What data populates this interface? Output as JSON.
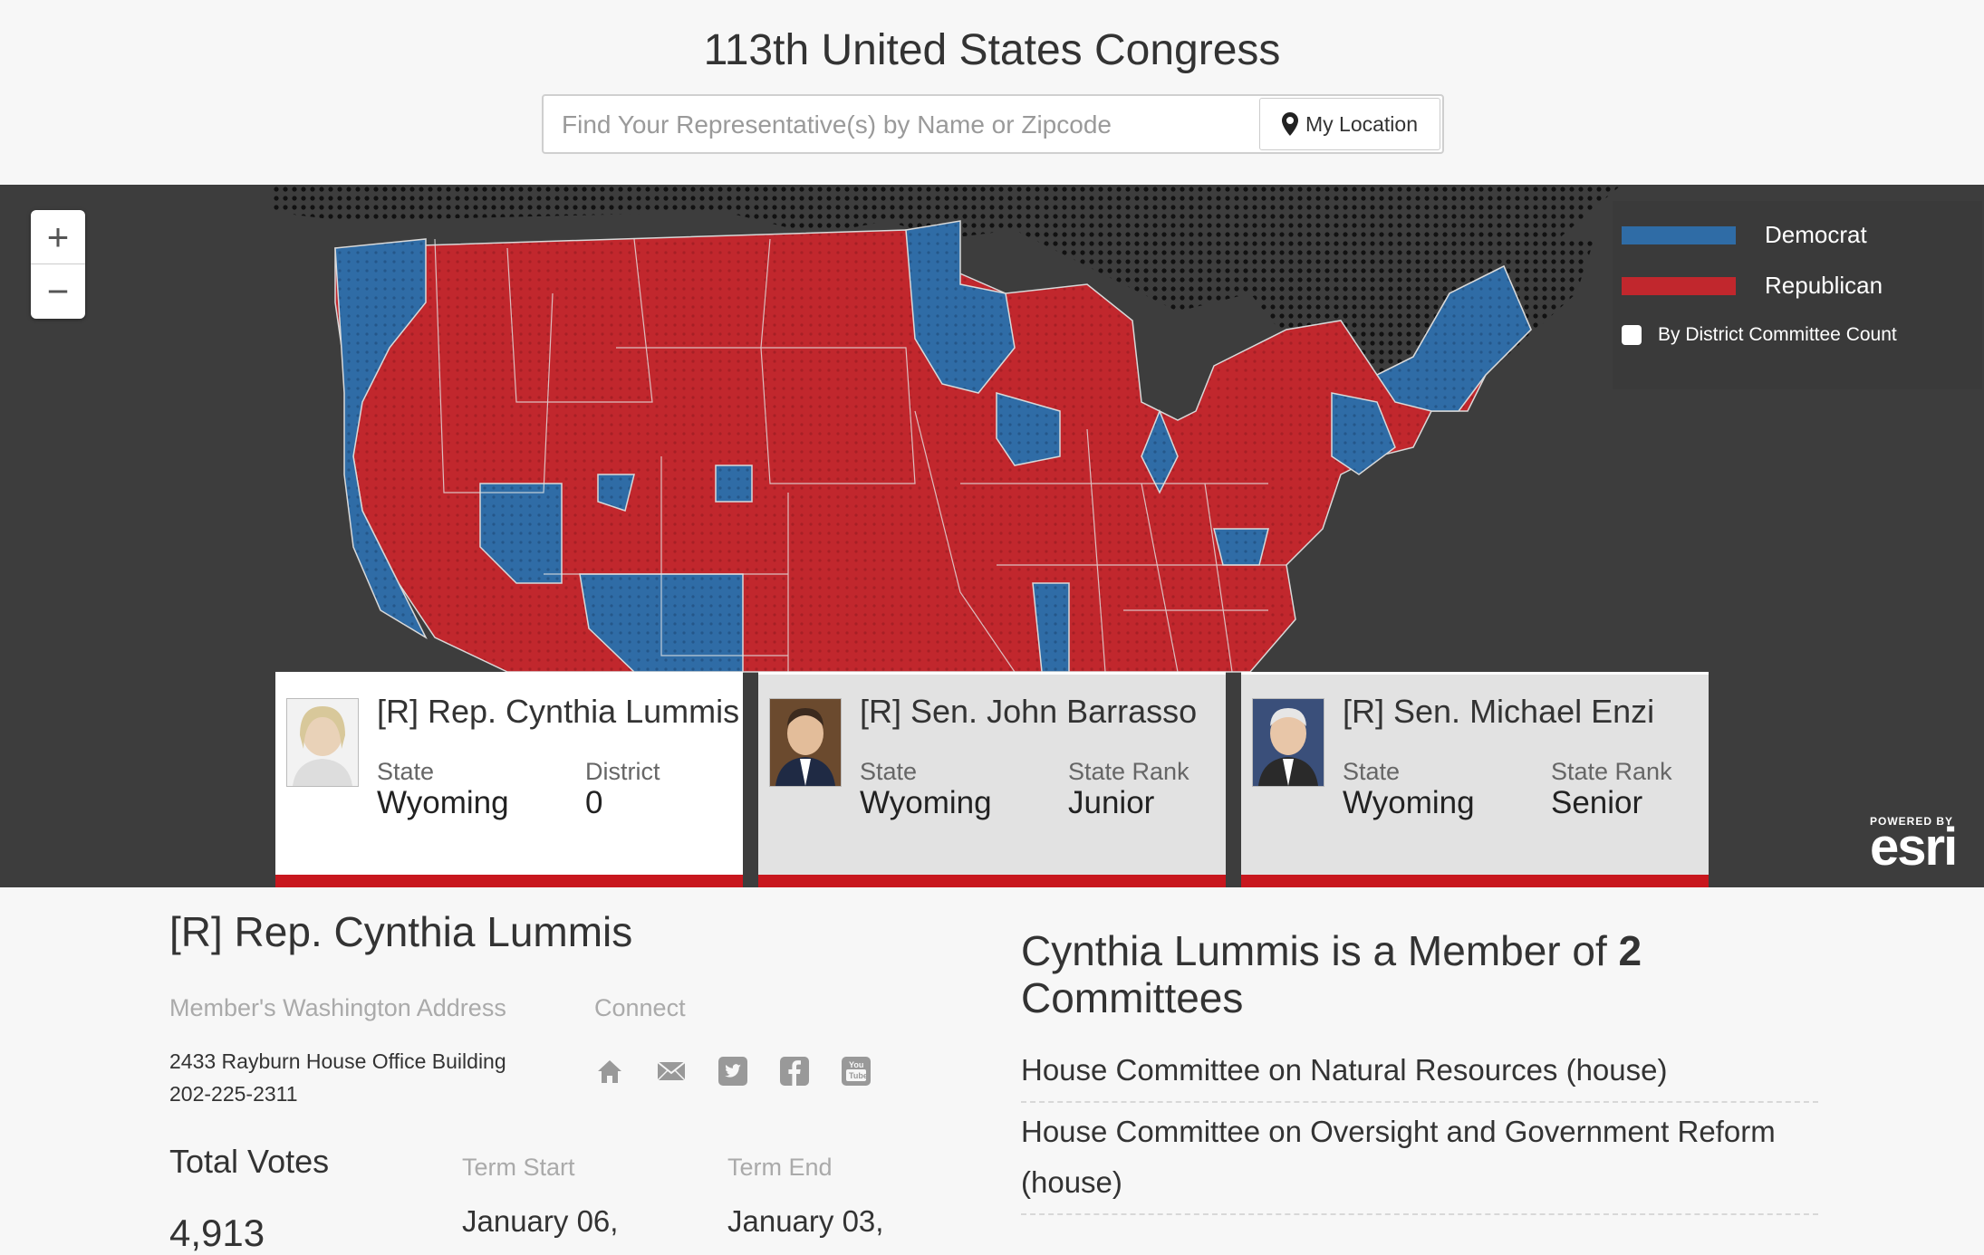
{
  "header": {
    "title": "113th United States Congress",
    "search_placeholder": "Find Your Representative(s) by Name or Zipcode",
    "location_button": "My Location"
  },
  "map": {
    "zoom_in": "+",
    "zoom_out": "−",
    "legend": {
      "democrat": "Democrat",
      "republican": "Republican",
      "checkbox_label": "By District Committee Count"
    },
    "colors": {
      "democrat": "#2f6ca6",
      "republican": "#c1272d",
      "background": "#3d3d3d"
    },
    "powered_by": "POWERED BY",
    "esri": "esri"
  },
  "cards": [
    {
      "name": "[R] Rep. Cynthia Lummis",
      "k1": "State",
      "v1": "Wyoming",
      "k2": "District",
      "v2": "0"
    },
    {
      "name": "[R] Sen. John Barrasso",
      "k1": "State",
      "v1": "Wyoming",
      "k2": "State Rank",
      "v2": "Junior"
    },
    {
      "name": "[R] Sen. Michael Enzi",
      "k1": "State",
      "v1": "Wyoming",
      "k2": "State Rank",
      "v2": "Senior"
    }
  ],
  "detail": {
    "name": "[R] Rep. Cynthia Lummis",
    "address_label": "Member's Washington Address",
    "address_line1": "2433 Rayburn House Office Building",
    "phone": "202-225-2311",
    "connect_label": "Connect",
    "connect_icons": [
      "home-icon",
      "mail-icon",
      "twitter-icon",
      "facebook-icon",
      "youtube-icon"
    ],
    "total_votes_label": "Total Votes",
    "total_votes": "4,913",
    "term_start_label": "Term Start",
    "term_start": "January 06,",
    "term_end_label": "Term End",
    "term_end": "January 03,"
  },
  "committees": {
    "title_prefix": "Cynthia Lummis is a Member of",
    "count": "2",
    "title_suffix": "Committees",
    "items": [
      "House Committee on Natural Resources (house)",
      "House Committee on Oversight and Government Reform (house)"
    ]
  }
}
